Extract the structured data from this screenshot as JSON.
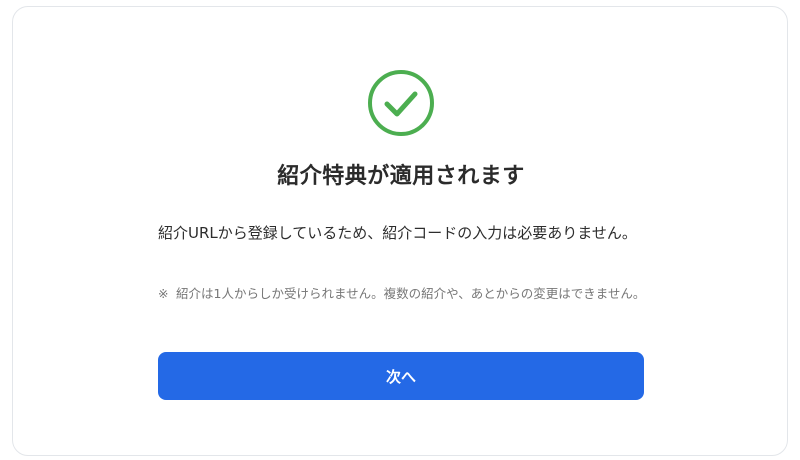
{
  "success": {
    "icon": "check-circle-icon",
    "color": "#4cae50"
  },
  "dialog": {
    "title": "紹介特典が適用されます",
    "message": "紹介URLから登録しているため、紹介コードの入力は必要ありません。",
    "note_mark": "※",
    "note": "紹介は1人からしか受けられません。複数の紹介や、あとからの変更はできません。",
    "next_button": "次へ"
  },
  "colors": {
    "primary": "#2469e6",
    "title_text": "#2b2b2b",
    "note_text": "#777777"
  }
}
